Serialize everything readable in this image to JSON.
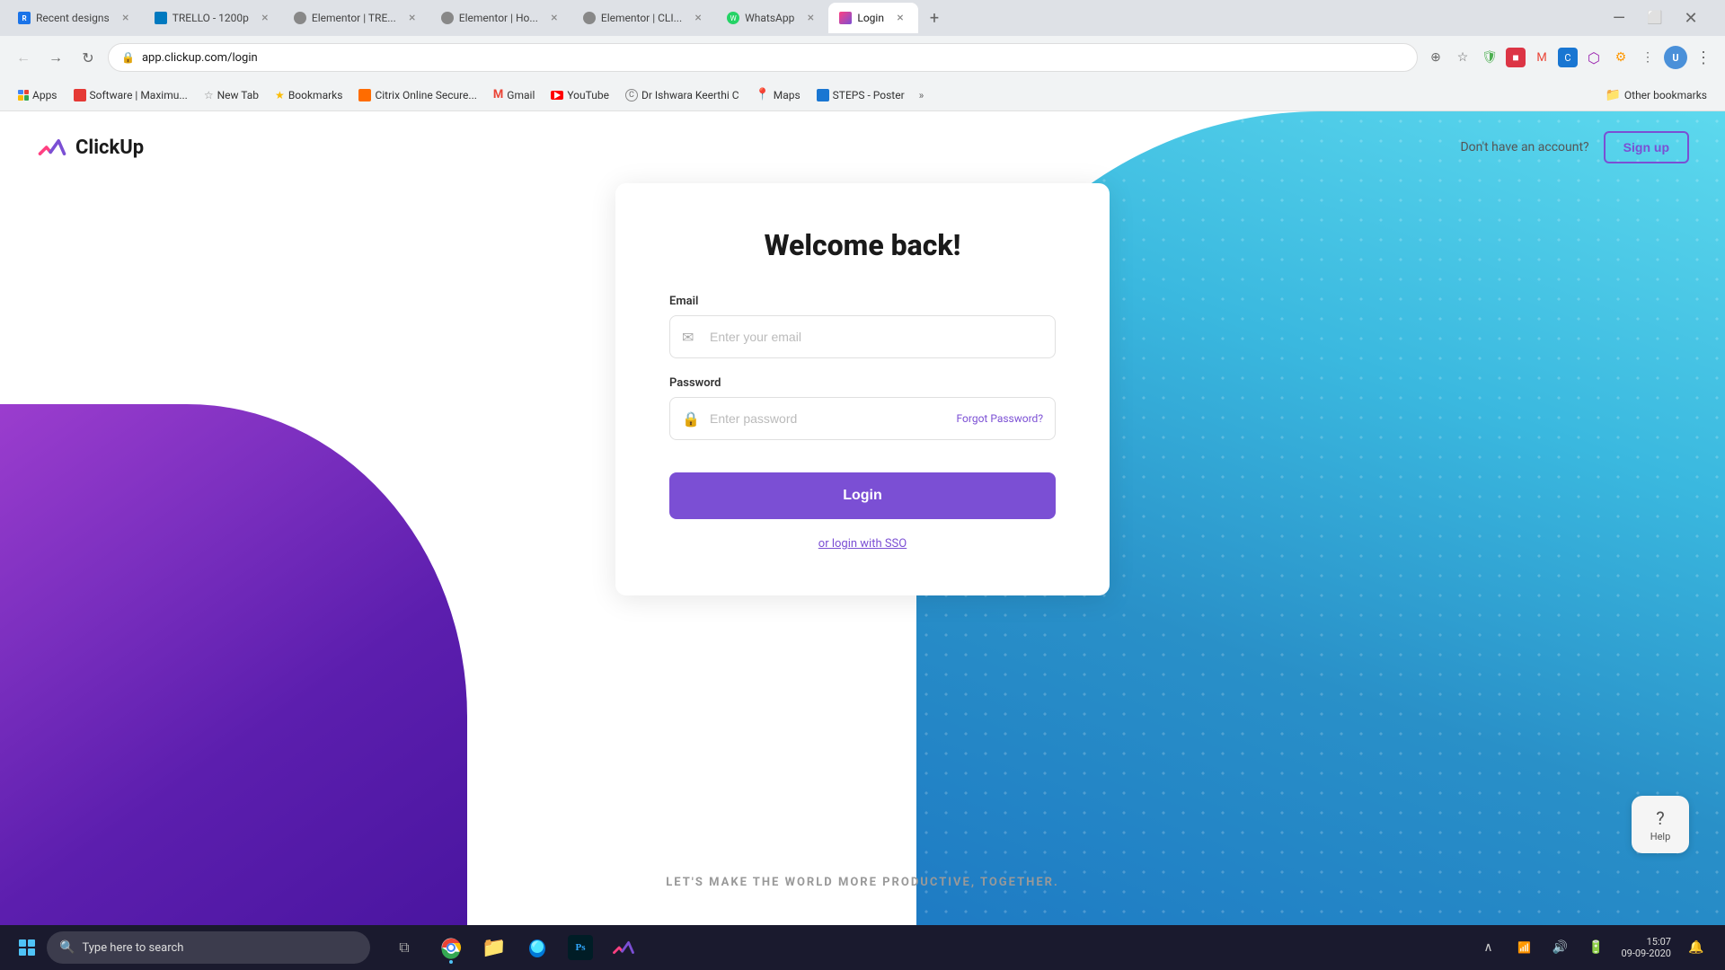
{
  "browser": {
    "tabs": [
      {
        "id": "tab-recent",
        "title": "Recent designs",
        "favicon_color": "#1a73e8",
        "favicon_letter": "R",
        "active": false
      },
      {
        "id": "tab-trello",
        "title": "TRELLO - 1200p",
        "favicon_color": "#0079bf",
        "favicon_letter": "T",
        "active": false
      },
      {
        "id": "tab-elementor1",
        "title": "Elementor | TRE...",
        "favicon_color": "#92003b",
        "favicon_letter": "E",
        "active": false
      },
      {
        "id": "tab-elementor2",
        "title": "Elementor | Ho...",
        "favicon_color": "#92003b",
        "favicon_letter": "E",
        "active": false
      },
      {
        "id": "tab-elementor3",
        "title": "Elementor | CLI...",
        "favicon_color": "#92003b",
        "favicon_letter": "E",
        "active": false
      },
      {
        "id": "tab-whatsapp",
        "title": "WhatsApp",
        "favicon_color": "#25d366",
        "favicon_letter": "W",
        "active": false
      },
      {
        "id": "tab-login",
        "title": "Login",
        "favicon_color": "#7b4fd4",
        "favicon_letter": "C",
        "active": true
      }
    ],
    "address": "app.clickup.com/login",
    "bookmarks": [
      {
        "label": "Apps",
        "icon": "grid"
      },
      {
        "label": "Software | Maximu...",
        "icon": "bk"
      },
      {
        "label": "New Tab",
        "icon": "star"
      },
      {
        "label": "Bookmarks",
        "icon": "star"
      },
      {
        "label": "Citrix Online Secure...",
        "icon": "citrix"
      },
      {
        "label": "Gmail",
        "icon": "gmail"
      },
      {
        "label": "YouTube",
        "icon": "youtube"
      },
      {
        "label": "Dr Ishwara Keerthi C",
        "icon": "C"
      },
      {
        "label": "Maps",
        "icon": "maps"
      },
      {
        "label": "STEPS - Poster",
        "icon": "steps"
      }
    ],
    "other_bookmarks_label": "Other bookmarks"
  },
  "page": {
    "logo_text": "ClickUp",
    "no_account_text": "Don't have an account?",
    "signup_label": "Sign up",
    "welcome_title": "Welcome back!",
    "email_label": "Email",
    "email_placeholder": "Enter your email",
    "password_label": "Password",
    "password_placeholder": "Enter password",
    "forgot_password_label": "Forgot Password?",
    "login_label": "Login",
    "sso_label": "or login with SSO",
    "tagline": "LET'S MAKE THE WORLD MORE PRODUCTIVE, TOGETHER.",
    "help_label": "Help"
  },
  "taskbar": {
    "search_placeholder": "Type here to search",
    "apps": [
      "chrome",
      "file-explorer",
      "edge",
      "photoshop",
      "clickup"
    ],
    "time": "15:07",
    "date": "09-09-2020"
  }
}
